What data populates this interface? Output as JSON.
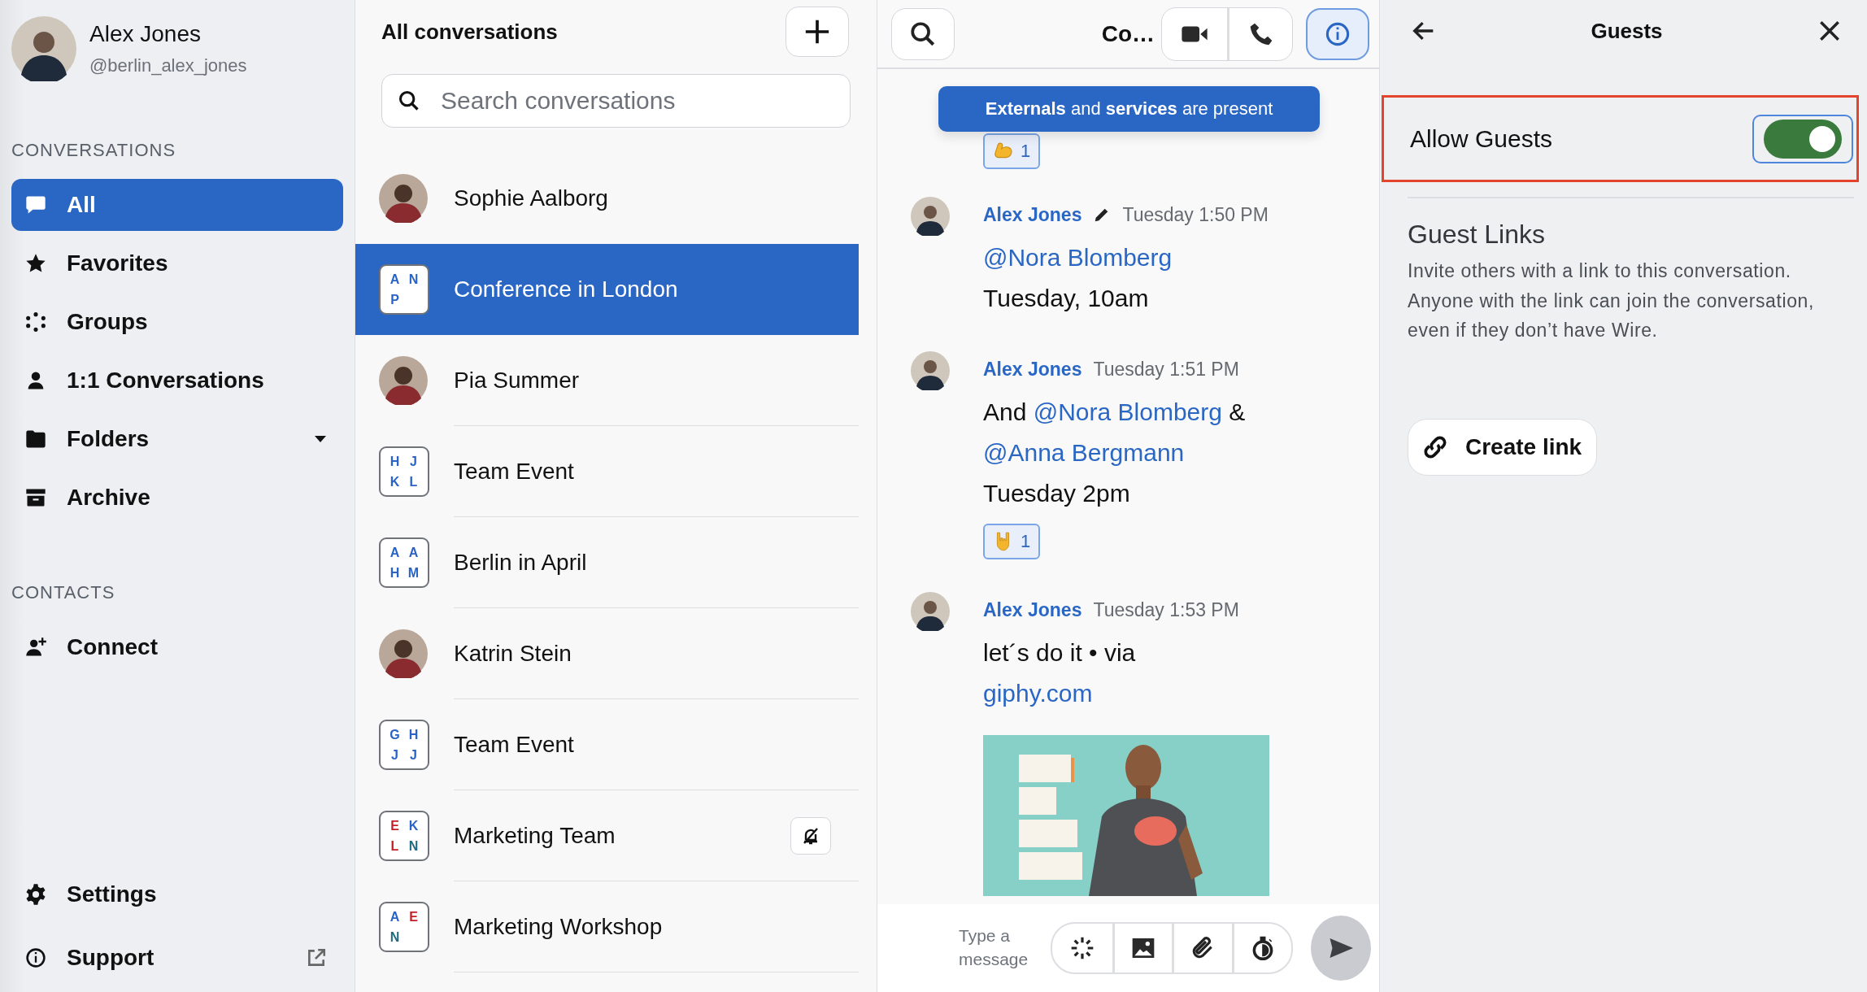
{
  "user": {
    "name": "Alex Jones",
    "handle": "@berlin_alex_jones"
  },
  "sidebar": {
    "sections": [
      {
        "heading": "CONVERSATIONS",
        "items": [
          {
            "kind": "all",
            "label": "All",
            "selected": true
          },
          {
            "kind": "favorites",
            "label": "Favorites",
            "selected": false
          },
          {
            "kind": "groups",
            "label": "Groups",
            "selected": false
          },
          {
            "kind": "one_to_one",
            "label": "1:1 Conversations",
            "selected": false
          },
          {
            "kind": "folders",
            "label": "Folders",
            "selected": false
          },
          {
            "kind": "archive",
            "label": "Archive",
            "selected": false
          }
        ]
      },
      {
        "heading": "CONTACTS",
        "items": [
          {
            "kind": "connect",
            "label": "Connect",
            "selected": false
          }
        ]
      }
    ],
    "footer": [
      {
        "kind": "settings",
        "label": "Settings"
      },
      {
        "kind": "support",
        "label": "Support"
      }
    ]
  },
  "conversation_list": {
    "title": "All conversations",
    "search": {
      "placeholder": "Search conversations"
    },
    "items": [
      {
        "kind": "person",
        "name": "Sophie Aalborg",
        "selected": false,
        "muted": false
      },
      {
        "kind": "group",
        "name": "Conference in London",
        "selected": true,
        "muted": false,
        "initials": [
          {
            "text": "A",
            "color": "#2a63c6"
          },
          {
            "text": "N",
            "color": "#2a63c6"
          },
          {
            "text": "P",
            "color": "#2a63c6"
          }
        ]
      },
      {
        "kind": "person",
        "name": "Pia Summer",
        "selected": false,
        "muted": false
      },
      {
        "kind": "group",
        "name": "Team Event",
        "selected": false,
        "muted": false,
        "initials": [
          {
            "text": "H",
            "color": "#2a63c6"
          },
          {
            "text": "J",
            "color": "#2a63c6"
          },
          {
            "text": "K",
            "color": "#2a63c6"
          },
          {
            "text": "L",
            "color": "#2a63c6"
          }
        ]
      },
      {
        "kind": "group",
        "name": "Berlin in April",
        "selected": false,
        "muted": false,
        "initials": [
          {
            "text": "A",
            "color": "#2a63c6"
          },
          {
            "text": "A",
            "color": "#2a63c6"
          },
          {
            "text": "H",
            "color": "#2a63c6"
          },
          {
            "text": "M",
            "color": "#2a63c6"
          }
        ]
      },
      {
        "kind": "person",
        "name": "Katrin Stein",
        "selected": false,
        "muted": false
      },
      {
        "kind": "group",
        "name": "Team Event",
        "selected": false,
        "muted": false,
        "initials": [
          {
            "text": "G",
            "color": "#2a63c6"
          },
          {
            "text": "H",
            "color": "#2a63c6"
          },
          {
            "text": "J",
            "color": "#2a63c6"
          },
          {
            "text": "J",
            "color": "#2a63c6"
          }
        ]
      },
      {
        "kind": "group",
        "name": "Marketing Team",
        "selected": false,
        "muted": true,
        "initials": [
          {
            "text": "E",
            "color": "#c22026"
          },
          {
            "text": "K",
            "color": "#2a63c6"
          },
          {
            "text": "L",
            "color": "#c22026"
          },
          {
            "text": "N",
            "color": "#1f6b80"
          }
        ]
      },
      {
        "kind": "group",
        "name": "Marketing Workshop",
        "selected": false,
        "muted": false,
        "initials": [
          {
            "text": "A",
            "color": "#2a63c6"
          },
          {
            "text": "E",
            "color": "#c22026"
          },
          {
            "text": "N",
            "color": "#1f6b80"
          }
        ]
      }
    ]
  },
  "chat": {
    "title": "Co…",
    "info_button": {
      "selected": true
    },
    "banner": "**Externals** and **services** are present",
    "top_reaction": {
      "kind": "flexed_arm",
      "count": "1",
      "selected": true
    },
    "messages": [
      {
        "author": "Alex Jones",
        "edited": true,
        "time": "Tuesday 1:50 PM",
        "body": [
          {
            "kind": "mention",
            "text": "@Nora Blomberg"
          },
          {
            "kind": "text",
            "text": "Tuesday, 10am"
          }
        ]
      },
      {
        "author": "Alex Jones",
        "edited": false,
        "time": "Tuesday 1:51 PM",
        "body": [
          {
            "kind": "text",
            "text": "And"
          },
          {
            "kind": "mention",
            "text": "@Nora Blomberg"
          },
          {
            "kind": "text",
            "text": "&"
          },
          {
            "kind": "mention",
            "text": "@Anna Bergmann"
          },
          {
            "kind": "text",
            "text": "Tuesday 2pm"
          }
        ],
        "reaction": {
          "kind": "horns",
          "count": "1",
          "selected": true
        }
      },
      {
        "author": "Alex Jones",
        "edited": false,
        "time": "Tuesday 1:53 PM",
        "body": [
          {
            "kind": "text",
            "text": "let´s do it • via"
          },
          {
            "kind": "link",
            "text": "giphy.com"
          }
        ],
        "attachment": {
          "kind": "picture"
        }
      }
    ],
    "composer": {
      "placeholder": "Type a message"
    }
  },
  "guests_panel": {
    "title": "Guests",
    "allow_guests": {
      "label": "Allow Guests",
      "on": true,
      "highlighted": true
    },
    "guest_links": {
      "heading": "Guest Links",
      "description": "Invite others with a link to this conversation. Anyone with the link can join the conversation, even if they don’t have Wire.",
      "button": "Create link"
    }
  }
}
